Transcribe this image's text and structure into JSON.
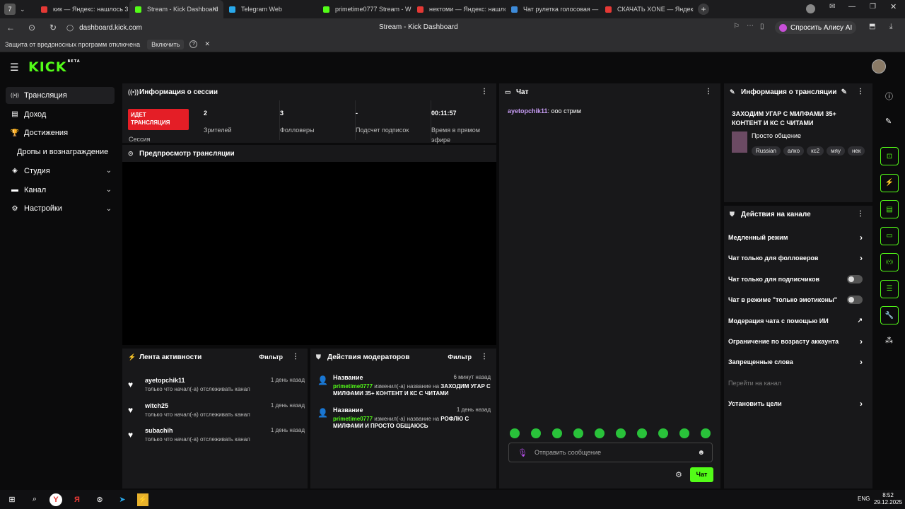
{
  "browser": {
    "tabs": [
      {
        "label": "кик — Яндекс: нашлось 3",
        "color": "#e53935"
      },
      {
        "label": "Stream - Kick Dashboard",
        "color": "#53fc18",
        "active": true
      },
      {
        "label": "Telegram Web",
        "color": "#29a9eb"
      },
      {
        "label": "primetime0777 Stream - W",
        "color": "#53fc18"
      },
      {
        "label": "нектоми — Яндекс: нашло",
        "color": "#e53935"
      },
      {
        "label": "Чат рулетка голосовая —",
        "color": "#3d8bd9"
      },
      {
        "label": "СКАЧАТЬ XONE — Яндекс",
        "color": "#e53935"
      }
    ],
    "tab_number": "7",
    "url": "dashboard.kick.com",
    "page_title": "Stream - Kick Dashboard",
    "alice_label": "Спросить Алису AI",
    "infobar_text": "Защита от вредоносных программ отключена",
    "infobar_button": "Включить"
  },
  "app": {
    "logo": "KICK",
    "logo_badge": "BETA",
    "sidebar": [
      {
        "label": "Трансляция",
        "icon": "broadcast-icon",
        "active": true,
        "chevron": false
      },
      {
        "label": "Доход",
        "icon": "income-icon",
        "chevron": false
      },
      {
        "label": "Достижения",
        "icon": "trophy-icon",
        "chevron": false
      },
      {
        "label": "Дропы и вознаграждение",
        "icon": "",
        "chevron": false
      },
      {
        "label": "Студия",
        "icon": "studio-icon",
        "chevron": true
      },
      {
        "label": "Канал",
        "icon": "channel-icon",
        "chevron": true
      },
      {
        "label": "Настройки",
        "icon": "gear-icon",
        "chevron": true
      }
    ],
    "session": {
      "title": "Информация о сессии",
      "live_badge": "ИДЕТ ТРАНСЛЯЦИЯ",
      "session_label": "Сессия",
      "stats": [
        {
          "value": "2",
          "label": "Зрителей"
        },
        {
          "value": "3",
          "label": "Фолловеры"
        },
        {
          "value": "-",
          "label": "Подсчет подписок"
        },
        {
          "value": "00:11:57",
          "label": "Время в прямом эфире"
        }
      ]
    },
    "preview": {
      "title": "Предпросмотр трансляции"
    },
    "activity": {
      "title": "Лента активности",
      "filter": "Фильтр",
      "items": [
        {
          "name": "ayetopchik11",
          "text": "только что начал(-а) отслеживать канал",
          "time": "1 день назад"
        },
        {
          "name": "witch25",
          "text": "только что начал(-а) отслеживать канал",
          "time": "1 день назад"
        },
        {
          "name": "subachih",
          "text": "только что начал(-а) отслеживать канал",
          "time": "1 день назад"
        }
      ]
    },
    "mod_actions": {
      "title": "Действия модераторов",
      "filter": "Фильтр",
      "items": [
        {
          "type": "Название",
          "time": "6 минут назад",
          "user": "primetime0777",
          "action": "изменил(-а) название на",
          "value": "ЗАХОДИМ УГАР С МИЛФАМИ 35+ КОНТЕНТ И КС С ЧИТАМИ"
        },
        {
          "type": "Название",
          "time": "1 день назад",
          "user": "primetime0777",
          "action": "изменил(-а) название на",
          "value": "РОФЛЮ С МИЛФАМИ И ПРОСТО ОБЩАЮСЬ"
        }
      ]
    },
    "chat": {
      "title": "Чат",
      "messages": [
        {
          "user": "ayetopchik11",
          "text": "ооо стрим"
        }
      ],
      "input_placeholder": "Отправить сообщение",
      "send_button": "Чат"
    },
    "stream_info": {
      "title": "Информация о трансляции",
      "stream_title": "ЗАХОДИМ УГАР С МИЛФАМИ 35+ КОНТЕНТ И КС С ЧИТАМИ",
      "category": "Просто общение",
      "tags": [
        "Russian",
        "алко",
        "кс2",
        "мяу",
        "нек"
      ]
    },
    "channel_actions": {
      "title": "Действия на канале",
      "items": [
        {
          "label": "Медленный режим",
          "control": "arrow"
        },
        {
          "label": "Чат только для фолловеров",
          "control": "arrow"
        },
        {
          "label": "Чат только для подписчиков",
          "control": "toggle"
        },
        {
          "label": "Чат в режиме \"только эмотиконы\"",
          "control": "toggle"
        },
        {
          "label": "Модерация чата с помощью ИИ",
          "control": "external"
        },
        {
          "label": "Ограничение по возрасту аккаунта",
          "control": "arrow"
        },
        {
          "label": "Запрещенные слова",
          "control": "arrow"
        },
        {
          "label": "Перейти на канал",
          "control": "none",
          "disabled": true
        },
        {
          "label": "Установить цели",
          "control": "arrow"
        }
      ]
    }
  },
  "taskbar": {
    "lang": "ENG",
    "time": "8:52",
    "date": "29.12.2025"
  },
  "colors": {
    "accent": "#53fc18",
    "live": "#e41e26",
    "panel": "#18181a",
    "bg": "#0b0b0c"
  }
}
